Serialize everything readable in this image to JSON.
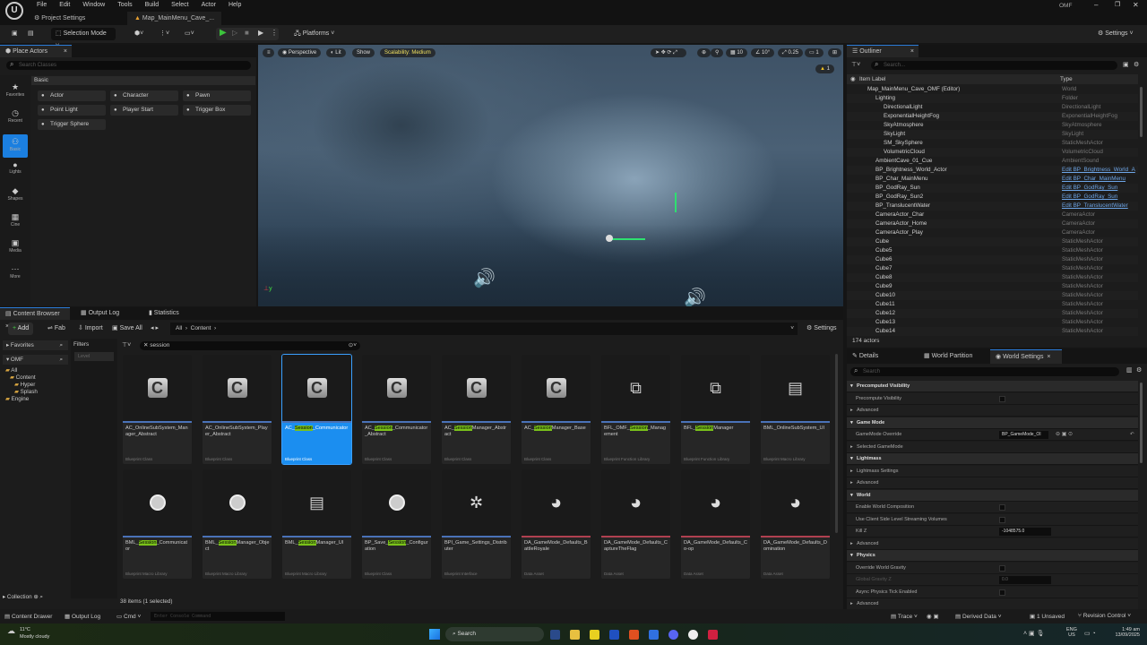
{
  "app": {
    "menu": [
      "File",
      "Edit",
      "Window",
      "Tools",
      "Build",
      "Select",
      "Actor",
      "Help"
    ],
    "tabs": [
      "Project Settings",
      "Map_MainMenu_Cave_..."
    ],
    "project": "OMF"
  },
  "toolbar": {
    "selection_mode": "Selection Mode",
    "platforms": "Platforms",
    "settings": "Settings"
  },
  "place_actors": {
    "title": "Place Actors",
    "search_placeholder": "Search Classes",
    "category": "Basic",
    "strip": [
      "Favorites",
      "Recent",
      "Basic",
      "Lights",
      "Shapes",
      "Cine",
      "Media",
      "More"
    ],
    "items": [
      "Actor",
      "Character",
      "Pawn",
      "Point Light",
      "Player Start",
      "Trigger Box",
      "Trigger Sphere"
    ]
  },
  "viewport": {
    "perspective": "Perspective",
    "lit": "Lit",
    "show": "Show",
    "scalability": "Scalability: Medium",
    "grid": "10",
    "angle": "10°",
    "scale": "0.25",
    "camera": "1",
    "warning": "1"
  },
  "outliner": {
    "title": "Outliner",
    "search_placeholder": "Search...",
    "col_label": "Item Label",
    "col_type": "Type",
    "footer": "174 actors",
    "rows": [
      {
        "label": "Map_MainMenu_Cave_OMF (Editor)",
        "type": "World",
        "indent": 1
      },
      {
        "label": "Lighting",
        "type": "Folder",
        "indent": 2
      },
      {
        "label": "DirectionalLight",
        "type": "DirectionalLight",
        "indent": 3
      },
      {
        "label": "ExponentialHeightFog",
        "type": "ExponentialHeightFog",
        "indent": 3
      },
      {
        "label": "SkyAtmosphere",
        "type": "SkyAtmosphere",
        "indent": 3
      },
      {
        "label": "SkyLight",
        "type": "SkyLight",
        "indent": 3
      },
      {
        "label": "SM_SkySphere",
        "type": "StaticMeshActor",
        "indent": 3
      },
      {
        "label": "VolumetricCloud",
        "type": "VolumetricCloud",
        "indent": 3
      },
      {
        "label": "AmbientCave_01_Cue",
        "type": "AmbientSound",
        "indent": 2
      },
      {
        "label": "BP_Brightness_World_Actor",
        "type": "Edit BP_Brightness_World_A",
        "indent": 2,
        "link": true
      },
      {
        "label": "BP_Char_MainMenu",
        "type": "Edit BP_Char_MainMenu",
        "indent": 2,
        "link": true
      },
      {
        "label": "BP_GodRay_Sun",
        "type": "Edit BP_GodRay_Sun",
        "indent": 2,
        "link": true
      },
      {
        "label": "BP_GodRay_Sun2",
        "type": "Edit BP_GodRay_Sun",
        "indent": 2,
        "link": true
      },
      {
        "label": "BP_TranslucentWater",
        "type": "Edit BP_TranslucentWater",
        "indent": 2,
        "link": true
      },
      {
        "label": "CameraActor_Char",
        "type": "CameraActor",
        "indent": 2
      },
      {
        "label": "CameraActor_Home",
        "type": "CameraActor",
        "indent": 2
      },
      {
        "label": "CameraActor_Play",
        "type": "CameraActor",
        "indent": 2
      },
      {
        "label": "Cube",
        "type": "StaticMeshActor",
        "indent": 2
      },
      {
        "label": "Cube5",
        "type": "StaticMeshActor",
        "indent": 2
      },
      {
        "label": "Cube6",
        "type": "StaticMeshActor",
        "indent": 2
      },
      {
        "label": "Cube7",
        "type": "StaticMeshActor",
        "indent": 2
      },
      {
        "label": "Cube8",
        "type": "StaticMeshActor",
        "indent": 2
      },
      {
        "label": "Cube9",
        "type": "StaticMeshActor",
        "indent": 2
      },
      {
        "label": "Cube10",
        "type": "StaticMeshActor",
        "indent": 2
      },
      {
        "label": "Cube11",
        "type": "StaticMeshActor",
        "indent": 2
      },
      {
        "label": "Cube12",
        "type": "StaticMeshActor",
        "indent": 2
      },
      {
        "label": "Cube13",
        "type": "StaticMeshActor",
        "indent": 2
      },
      {
        "label": "Cube14",
        "type": "StaticMeshActor",
        "indent": 2
      }
    ]
  },
  "content_browser": {
    "tabs": [
      "Content Browser",
      "Output Log",
      "Statistics"
    ],
    "add": "Add",
    "fab": "Fab",
    "import": "Import",
    "save_all": "Save All",
    "path": [
      "All",
      "Content"
    ],
    "settings": "Settings",
    "favorites": "Favorites",
    "root": "OMF",
    "tree": [
      "All",
      "Content",
      "Hyper",
      "Splash",
      "Engine"
    ],
    "filters": "Filters",
    "filter_level": "Level",
    "search": "session",
    "collections": "Collection",
    "status": "38 items (1 selected)",
    "assets": [
      {
        "name": "AC_OnlineSubSystem_Manager_Abstract",
        "kind": "Blueprint Class",
        "icon": "c"
      },
      {
        "name": "AC_OnlineSubSystem_Player_Abstract",
        "kind": "Blueprint Class",
        "icon": "c"
      },
      {
        "name": "AC_Session_Communicator",
        "kind": "Blueprint Class",
        "icon": "c",
        "selected": true
      },
      {
        "name": "AC_Session_Communicator_Abstract",
        "kind": "Blueprint Class",
        "icon": "c"
      },
      {
        "name": "AC_SessionManager_Abstract",
        "kind": "Blueprint Class",
        "icon": "c"
      },
      {
        "name": "AC_SessionManager_Base",
        "kind": "Blueprint Class",
        "icon": "c"
      },
      {
        "name": "BFL_OMF_Session_Management",
        "kind": "Blueprint Function Library",
        "icon": "f"
      },
      {
        "name": "BFL_SessionManager",
        "kind": "Blueprint Function Library",
        "icon": "f"
      },
      {
        "name": "BML_OnlineSubSystem_UI",
        "kind": "Blueprint Macro Library",
        "icon": "m"
      },
      {
        "name": "BML_Session_Communicator",
        "kind": "Blueprint Macro Library",
        "icon": "o"
      },
      {
        "name": "BML_SessionManager_Object",
        "kind": "Blueprint Macro Library",
        "icon": "o"
      },
      {
        "name": "BML_SessionManager_UI",
        "kind": "Blueprint Macro Library",
        "icon": "m"
      },
      {
        "name": "BP_Save_Session_Configuration",
        "kind": "Blueprint Class",
        "icon": "o"
      },
      {
        "name": "BPI_Game_Settings_Distributer",
        "kind": "Blueprint Interface",
        "icon": "g"
      },
      {
        "name": "DA_GameMode_Defaults_BattleRoyale",
        "kind": "Data Asset",
        "icon": "p",
        "da": true
      },
      {
        "name": "DA_GameMode_Defaults_CaptureTheFlag",
        "kind": "Data Asset",
        "icon": "p",
        "da": true
      },
      {
        "name": "DA_GameMode_Defaults_Co-op",
        "kind": "Data Asset",
        "icon": "p",
        "da": true
      },
      {
        "name": "DA_GameMode_Defaults_Domination",
        "kind": "Data Asset",
        "icon": "p",
        "da": true
      }
    ]
  },
  "details": {
    "tabs": [
      "Details",
      "World Partition",
      "World Settings"
    ],
    "search_placeholder": "Search",
    "rows": [
      {
        "t": "sec",
        "label": "Precomputed Visibility"
      },
      {
        "t": "prop",
        "label": "Precompute Visibility",
        "v": "chk"
      },
      {
        "t": "adv",
        "label": "Advanced"
      },
      {
        "t": "sec",
        "label": "Game Mode"
      },
      {
        "t": "prop",
        "label": "GameMode Override",
        "v": "sel",
        "value": "BP_GameMode_OI"
      },
      {
        "t": "adv",
        "label": "Selected GameMode"
      },
      {
        "t": "sec",
        "label": "Lightmass"
      },
      {
        "t": "adv",
        "label": "Lightmass Settings"
      },
      {
        "t": "adv",
        "label": "Advanced"
      },
      {
        "t": "sec",
        "label": "World"
      },
      {
        "t": "prop",
        "label": "Enable World Composition",
        "v": "chk"
      },
      {
        "t": "prop",
        "label": "Use Client Side Level Streaming Volumes",
        "v": "chk"
      },
      {
        "t": "prop",
        "label": "Kill Z",
        "v": "num",
        "value": "-1048575.0"
      },
      {
        "t": "adv",
        "label": "Advanced"
      },
      {
        "t": "sec",
        "label": "Physics"
      },
      {
        "t": "prop",
        "label": "Override World Gravity",
        "v": "chk"
      },
      {
        "t": "prop",
        "label": "Global Gravity Z",
        "v": "num",
        "value": "0.0",
        "dim": true
      },
      {
        "t": "prop",
        "label": "Async Physics Tick Enabled",
        "v": "chk"
      },
      {
        "t": "adv",
        "label": "Advanced"
      }
    ]
  },
  "statusbar": {
    "content_drawer": "Content Drawer",
    "output_log": "Output Log",
    "cmd": "Cmd",
    "console_placeholder": "Enter Console Command",
    "trace": "Trace",
    "derived": "Derived Data",
    "unsaved": "1 Unsaved",
    "revision": "Revision Control"
  },
  "taskbar": {
    "temp": "11°C",
    "weather": "Mostly cloudy",
    "search": "Search",
    "lang": "ENG",
    "region": "US",
    "time": "1:49 am",
    "date": "13/09/2025"
  }
}
